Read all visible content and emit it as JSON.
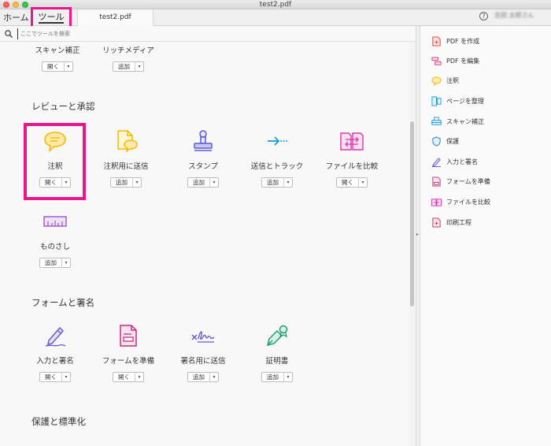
{
  "window": {
    "title": "test2.pdf"
  },
  "tabs": {
    "home": "ホーム",
    "tools": "ツール",
    "document": "test2.pdf"
  },
  "user": {
    "name": "吉田 太郎さん"
  },
  "search": {
    "placeholder": "ここでツールを検索"
  },
  "sections": {
    "top_row": {
      "tools": [
        {
          "name": "スキャン補正",
          "button": "開く"
        },
        {
          "name": "リッチメディア",
          "button": "追加"
        }
      ]
    },
    "review": {
      "title": "レビューと承認",
      "tools": [
        {
          "name": "注釈",
          "button": "開く"
        },
        {
          "name": "注釈用に送信",
          "button": "追加"
        },
        {
          "name": "スタンプ",
          "button": "追加"
        },
        {
          "name": "送信とトラック",
          "button": "追加"
        },
        {
          "name": "ファイルを比較",
          "button": "開く"
        },
        {
          "name": "ものさし",
          "button": "追加"
        }
      ]
    },
    "forms": {
      "title": "フォームと署名",
      "tools": [
        {
          "name": "入力と署名",
          "button": "開く"
        },
        {
          "name": "フォームを準備",
          "button": "開く"
        },
        {
          "name": "署名用に送信",
          "button": "追加"
        },
        {
          "name": "証明書",
          "button": "追加"
        }
      ]
    },
    "protect": {
      "title": "保護と標準化"
    }
  },
  "right_panel": {
    "items": [
      {
        "label": "PDF を作成",
        "icon": "create-pdf-icon"
      },
      {
        "label": "PDF を編集",
        "icon": "edit-pdf-icon"
      },
      {
        "label": "注釈",
        "icon": "comment-icon"
      },
      {
        "label": "ページを整理",
        "icon": "organize-pages-icon"
      },
      {
        "label": "スキャン補正",
        "icon": "enhance-scans-icon"
      },
      {
        "label": "保護",
        "icon": "protect-icon"
      },
      {
        "label": "入力と署名",
        "icon": "fill-sign-icon"
      },
      {
        "label": "フォームを準備",
        "icon": "prepare-form-icon"
      },
      {
        "label": "ファイルを比較",
        "icon": "compare-files-icon"
      },
      {
        "label": "印刷工程",
        "icon": "print-production-icon"
      }
    ]
  },
  "colors": {
    "highlight": "#e8168b",
    "comment": "#f5b800",
    "stamp": "#5b5bd6",
    "send": "#1a9ad6",
    "compare": "#d63aa8",
    "measure": "#9b59c6",
    "sign": "#6a5acd",
    "form": "#c0307f",
    "cert": "#1f9e77"
  }
}
